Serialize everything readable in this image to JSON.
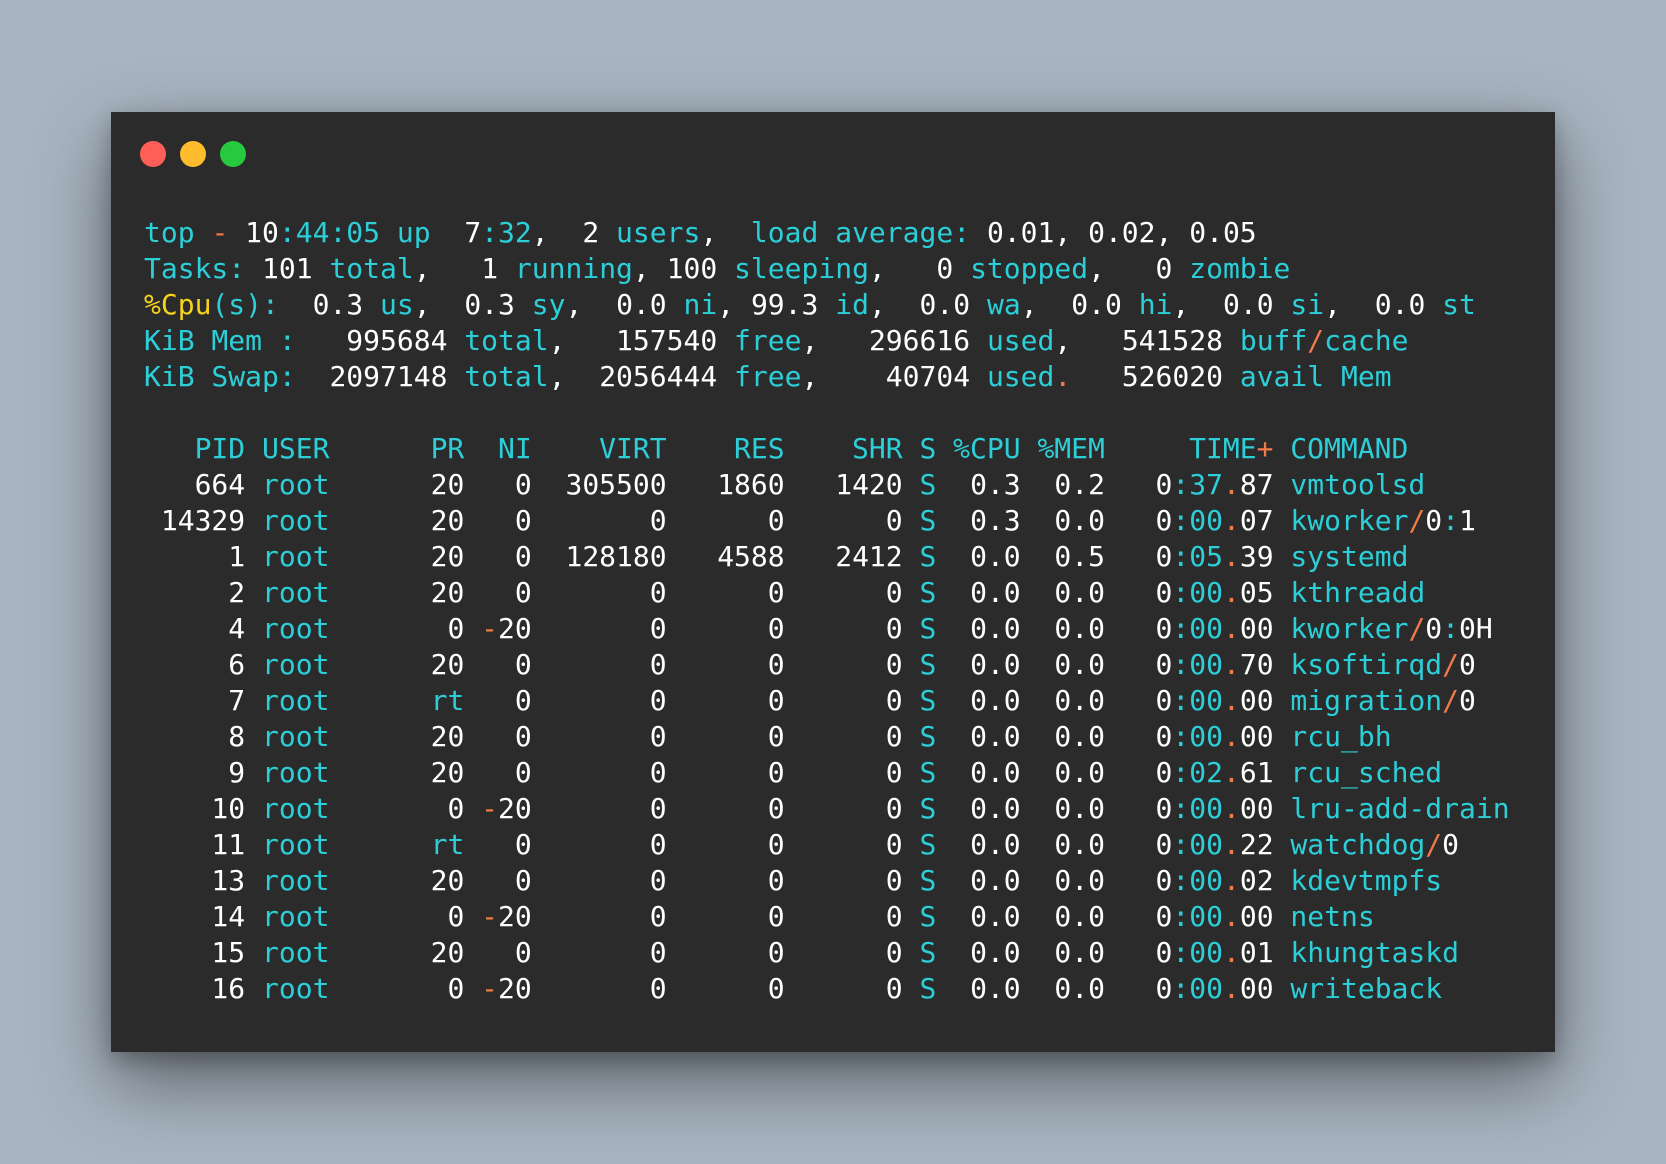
{
  "window": {
    "buttons": {
      "close": "close",
      "minimize": "minimize",
      "zoom": "zoom"
    }
  },
  "summary": {
    "top": [
      [
        "top ",
        "c"
      ],
      [
        "- ",
        "o"
      ],
      [
        "10",
        "w"
      ],
      [
        ":44:05 up  ",
        "c"
      ],
      [
        "7",
        "w"
      ],
      [
        ":32",
        "c"
      ],
      [
        ",  ",
        "w"
      ],
      [
        "2",
        "w"
      ],
      [
        " users",
        "c"
      ],
      [
        ",  ",
        "w"
      ],
      [
        "load average: ",
        "c"
      ],
      [
        "0.01, 0.02, 0.05",
        "w"
      ]
    ],
    "tasks": [
      [
        "Tasks: ",
        "c"
      ],
      [
        "101",
        "w"
      ],
      [
        " total",
        "c"
      ],
      [
        ",   ",
        "w"
      ],
      [
        "1",
        "w"
      ],
      [
        " running",
        "c"
      ],
      [
        ", ",
        "w"
      ],
      [
        "100",
        "w"
      ],
      [
        " sleeping",
        "c"
      ],
      [
        ",   ",
        "w"
      ],
      [
        "0",
        "w"
      ],
      [
        " stopped",
        "c"
      ],
      [
        ",   ",
        "w"
      ],
      [
        "0",
        "w"
      ],
      [
        " zombie",
        "c"
      ]
    ],
    "cpu": [
      [
        "%Cpu",
        "y"
      ],
      [
        "(s):  ",
        "c"
      ],
      [
        "0.3",
        "w"
      ],
      [
        " us",
        "c"
      ],
      [
        ",  ",
        "w"
      ],
      [
        "0.3",
        "w"
      ],
      [
        " sy",
        "c"
      ],
      [
        ",  ",
        "w"
      ],
      [
        "0.0",
        "w"
      ],
      [
        " ni",
        "c"
      ],
      [
        ", ",
        "w"
      ],
      [
        "99.3",
        "w"
      ],
      [
        " id",
        "c"
      ],
      [
        ",  ",
        "w"
      ],
      [
        "0.0",
        "w"
      ],
      [
        " wa",
        "c"
      ],
      [
        ",  ",
        "w"
      ],
      [
        "0.0",
        "w"
      ],
      [
        " hi",
        "c"
      ],
      [
        ",  ",
        "w"
      ],
      [
        "0.0",
        "w"
      ],
      [
        " si",
        "c"
      ],
      [
        ",  ",
        "w"
      ],
      [
        "0.0",
        "w"
      ],
      [
        " st",
        "c"
      ]
    ],
    "mem": [
      [
        "KiB Mem :   ",
        "c"
      ],
      [
        "995684",
        "w"
      ],
      [
        " total",
        "c"
      ],
      [
        ",   ",
        "w"
      ],
      [
        "157540",
        "w"
      ],
      [
        " free",
        "c"
      ],
      [
        ",   ",
        "w"
      ],
      [
        "296616",
        "w"
      ],
      [
        " used",
        "c"
      ],
      [
        ",   ",
        "w"
      ],
      [
        "541528",
        "w"
      ],
      [
        " buff",
        "c"
      ],
      [
        "/",
        "o"
      ],
      [
        "cache",
        "c"
      ]
    ],
    "swap": [
      [
        "KiB Swap:  ",
        "c"
      ],
      [
        "2097148",
        "w"
      ],
      [
        " total",
        "c"
      ],
      [
        ",  ",
        "w"
      ],
      [
        "2056444",
        "w"
      ],
      [
        " free",
        "c"
      ],
      [
        ",    ",
        "w"
      ],
      [
        "40704",
        "w"
      ],
      [
        " used",
        "c"
      ],
      [
        ".   ",
        "o"
      ],
      [
        "526020",
        "w"
      ],
      [
        " avail Mem",
        "c"
      ]
    ]
  },
  "header": [
    [
      "   PID USER      PR  NI    VIRT    RES    SHR S %CPU %MEM     TIME",
      "c"
    ],
    [
      "+",
      "o"
    ],
    [
      " COMMAND",
      "c"
    ]
  ],
  "processes": [
    {
      "pid": "664",
      "user": "root",
      "pr": "20",
      "ni": "0",
      "virt": "305500",
      "res": "1860",
      "shr": "1420",
      "s": "S",
      "cpu": "0.3",
      "mem": "0.2",
      "time": "0:37.87",
      "command": "vmtoolsd"
    },
    {
      "pid": "14329",
      "user": "root",
      "pr": "20",
      "ni": "0",
      "virt": "0",
      "res": "0",
      "shr": "0",
      "s": "S",
      "cpu": "0.3",
      "mem": "0.0",
      "time": "0:00.07",
      "command": "kworker/0:1"
    },
    {
      "pid": "1",
      "user": "root",
      "pr": "20",
      "ni": "0",
      "virt": "128180",
      "res": "4588",
      "shr": "2412",
      "s": "S",
      "cpu": "0.0",
      "mem": "0.5",
      "time": "0:05.39",
      "command": "systemd"
    },
    {
      "pid": "2",
      "user": "root",
      "pr": "20",
      "ni": "0",
      "virt": "0",
      "res": "0",
      "shr": "0",
      "s": "S",
      "cpu": "0.0",
      "mem": "0.0",
      "time": "0:00.05",
      "command": "kthreadd"
    },
    {
      "pid": "4",
      "user": "root",
      "pr": "0",
      "ni": "-20",
      "virt": "0",
      "res": "0",
      "shr": "0",
      "s": "S",
      "cpu": "0.0",
      "mem": "0.0",
      "time": "0:00.00",
      "command": "kworker/0:0H"
    },
    {
      "pid": "6",
      "user": "root",
      "pr": "20",
      "ni": "0",
      "virt": "0",
      "res": "0",
      "shr": "0",
      "s": "S",
      "cpu": "0.0",
      "mem": "0.0",
      "time": "0:00.70",
      "command": "ksoftirqd/0"
    },
    {
      "pid": "7",
      "user": "root",
      "pr": "rt",
      "ni": "0",
      "virt": "0",
      "res": "0",
      "shr": "0",
      "s": "S",
      "cpu": "0.0",
      "mem": "0.0",
      "time": "0:00.00",
      "command": "migration/0"
    },
    {
      "pid": "8",
      "user": "root",
      "pr": "20",
      "ni": "0",
      "virt": "0",
      "res": "0",
      "shr": "0",
      "s": "S",
      "cpu": "0.0",
      "mem": "0.0",
      "time": "0:00.00",
      "command": "rcu_bh"
    },
    {
      "pid": "9",
      "user": "root",
      "pr": "20",
      "ni": "0",
      "virt": "0",
      "res": "0",
      "shr": "0",
      "s": "S",
      "cpu": "0.0",
      "mem": "0.0",
      "time": "0:02.61",
      "command": "rcu_sched"
    },
    {
      "pid": "10",
      "user": "root",
      "pr": "0",
      "ni": "-20",
      "virt": "0",
      "res": "0",
      "shr": "0",
      "s": "S",
      "cpu": "0.0",
      "mem": "0.0",
      "time": "0:00.00",
      "command": "lru-add-drain"
    },
    {
      "pid": "11",
      "user": "root",
      "pr": "rt",
      "ni": "0",
      "virt": "0",
      "res": "0",
      "shr": "0",
      "s": "S",
      "cpu": "0.0",
      "mem": "0.0",
      "time": "0:00.22",
      "command": "watchdog/0"
    },
    {
      "pid": "13",
      "user": "root",
      "pr": "20",
      "ni": "0",
      "virt": "0",
      "res": "0",
      "shr": "0",
      "s": "S",
      "cpu": "0.0",
      "mem": "0.0",
      "time": "0:00.02",
      "command": "kdevtmpfs"
    },
    {
      "pid": "14",
      "user": "root",
      "pr": "0",
      "ni": "-20",
      "virt": "0",
      "res": "0",
      "shr": "0",
      "s": "S",
      "cpu": "0.0",
      "mem": "0.0",
      "time": "0:00.00",
      "command": "netns"
    },
    {
      "pid": "15",
      "user": "root",
      "pr": "20",
      "ni": "0",
      "virt": "0",
      "res": "0",
      "shr": "0",
      "s": "S",
      "cpu": "0.0",
      "mem": "0.0",
      "time": "0:00.01",
      "command": "khungtaskd"
    },
    {
      "pid": "16",
      "user": "root",
      "pr": "0",
      "ni": "-20",
      "virt": "0",
      "res": "0",
      "shr": "0",
      "s": "S",
      "cpu": "0.0",
      "mem": "0.0",
      "time": "0:00.00",
      "command": "writeback"
    }
  ],
  "colors": {
    "background": "#a8b4c0",
    "window": "#2b2b2b",
    "cyan": "#2ccfd8",
    "white": "#ffffff",
    "orange": "#f07a4a",
    "yellow": "#f5d21c",
    "close": "#ff5f56",
    "minimize": "#ffbd2e",
    "zoom": "#27c93f"
  }
}
